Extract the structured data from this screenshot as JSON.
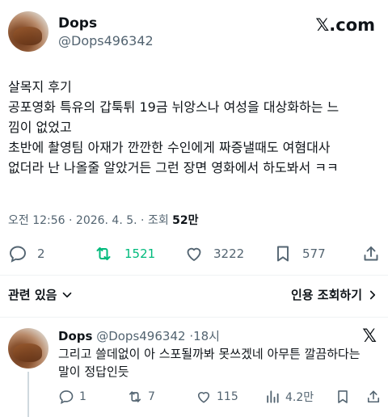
{
  "tweet": {
    "author_name": "Dops",
    "author_handle": "@Dops496342",
    "brand": "𝕏.com",
    "lines": [
      "살목지 후기",
      "공포영화 특유의 갑툭튀 19금 뉘앙스나 여성을 대상화하는 느",
      "낌이 없었고",
      "초반에 촬영팀 아재가 깐깐한 수인에게 짜증낼때도 여혐대사",
      "없더라 난 나올줄 알았거든 그런 장면 영화에서 하도봐서 ㅋㅋ"
    ],
    "time": "오전 12:56 · 2026. 4. 5. · 조회 ",
    "views": "52만",
    "stats": {
      "replies": "2",
      "retweets": "1521",
      "likes": "3222",
      "bookmarks": "577"
    },
    "retweet_color": "#00ba7c"
  },
  "related": {
    "label": "관련 있음",
    "sort_label": "인용 조회하기"
  },
  "reply": {
    "author_name": "Dops",
    "author_handle": "@Dops496342",
    "sep": "·",
    "age": "18시",
    "lines": [
      "그리고 쓸데없이 아 스포될까봐 못쓰겠네 아무튼 깔끔하다는",
      "말이 정답인듯"
    ],
    "stats": {
      "replies": "1",
      "retweets": "7",
      "likes": "115",
      "views": "4.2만"
    }
  }
}
